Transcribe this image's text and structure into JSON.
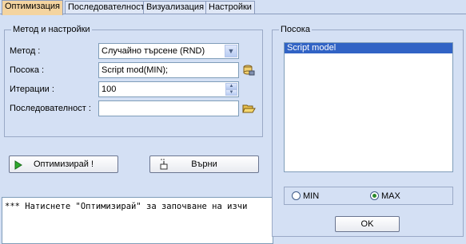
{
  "tabs": [
    {
      "label": "Оптимизация",
      "active": true
    },
    {
      "label": "Последователност",
      "active": false
    },
    {
      "label": "Визуализация",
      "active": false
    },
    {
      "label": "Настройки",
      "active": false
    }
  ],
  "method_group": {
    "title": "Метод и настройки",
    "method_label": "Метод :",
    "method_value": "Случайно търсене (RND)",
    "direction_label": "Посока :",
    "direction_value": "Script mod(MIN);",
    "iterations_label": "Итерации :",
    "iterations_value": "100",
    "sequence_label": "Последователност :",
    "sequence_value": ""
  },
  "buttons": {
    "optimize": "Оптимизирай !",
    "revert": "Върни"
  },
  "log": {
    "text": "*** Натиснете \"Оптимизирай\" за започване на изчи"
  },
  "direction_group": {
    "title": "Посока",
    "items": [
      "Script model"
    ],
    "selected_index": 0,
    "radio_min": "MIN",
    "radio_max": "MAX",
    "selected_radio": "MAX",
    "ok_label": "OK"
  },
  "colors": {
    "background": "#d4e0f4",
    "active_tab": "#f4d4a0",
    "selection": "#3163c5",
    "play_icon": "#2eaa2e"
  }
}
